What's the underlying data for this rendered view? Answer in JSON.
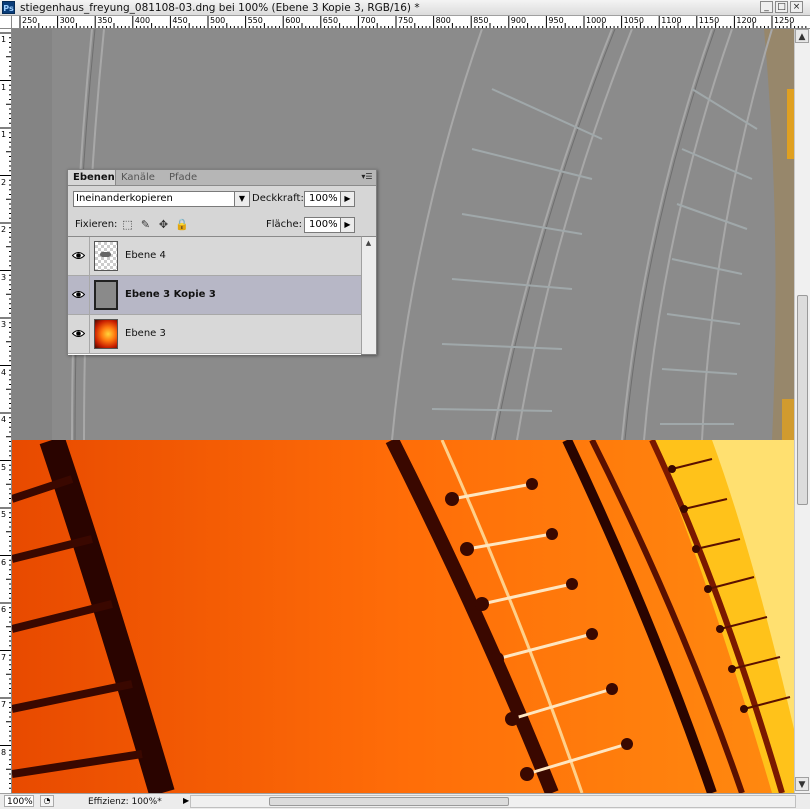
{
  "window": {
    "title": "stiegenhaus_freyung_081108-03.dng bei 100% (Ebene 3 Kopie 3, RGB/16) *",
    "app_icon": "Ps",
    "min_label": "_",
    "max_label": "□",
    "close_label": "×"
  },
  "ruler_h": [
    "250",
    "300",
    "350",
    "400",
    "450",
    "500",
    "550",
    "600",
    "650",
    "700",
    "750",
    "800",
    "850",
    "900",
    "950",
    "1000",
    "1050",
    "1100",
    "1150",
    "1200",
    "1250"
  ],
  "ruler_v": [
    "1",
    "1",
    "1",
    "2",
    "2",
    "3",
    "3",
    "4",
    "4",
    "5",
    "5",
    "6",
    "6",
    "7",
    "7",
    "8"
  ],
  "status": {
    "zoom": "100%",
    "info": "Effizienz: 100%*"
  },
  "panel": {
    "tabs": [
      "Ebenen",
      "Kanäle",
      "Pfade"
    ],
    "blend_mode": "Ineinanderkopieren",
    "opacity_label": "Deckkraft:",
    "opacity_value": "100%",
    "lock_label": "Fixieren:",
    "fill_label": "Fläche:",
    "fill_value": "100%",
    "layers": [
      {
        "name": "Ebene 4",
        "thumbnail": "transparent-checker",
        "selected": false
      },
      {
        "name": "Ebene 3 Kopie 3",
        "thumbnail": "gray-fill",
        "selected": true
      },
      {
        "name": "Ebene 3",
        "thumbnail": "orange-photo",
        "selected": false
      }
    ]
  },
  "colors": {
    "gray_overlay": "#8b8b8b",
    "orange": "#ff6a00",
    "selection": "#b7b7c6"
  }
}
